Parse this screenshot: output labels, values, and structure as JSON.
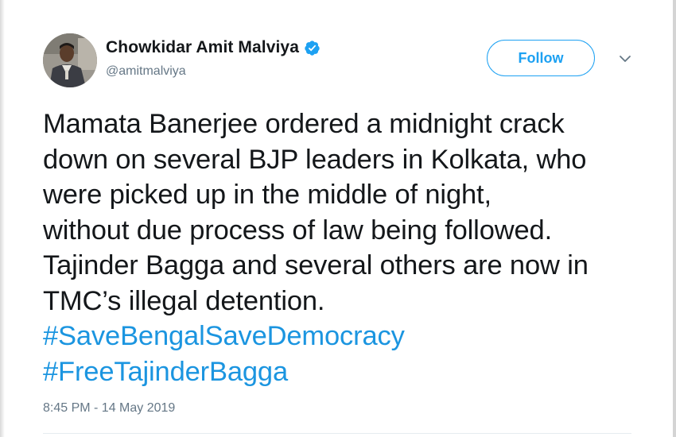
{
  "author": {
    "display_name": "Chowkidar Amit Malviya",
    "handle": "@amitmalviya",
    "verified": true
  },
  "actions": {
    "follow_label": "Follow"
  },
  "tweet": {
    "lines": [
      "Mamata Banerjee ordered a midnight crack",
      "down on several BJP leaders in Kolkata, who",
      "were picked up in the middle of night,",
      "without due process of law being followed.",
      "Tajinder Bagga and several others are now in",
      "TMC’s illegal detention."
    ],
    "hashtags": [
      "#SaveBengalSaveDemocracy",
      "#FreeTajinderBagga"
    ],
    "timestamp": "8:45 PM - 14 May 2019"
  },
  "icons": {
    "verified": "verified-badge-icon",
    "more": "chevron-down-icon"
  },
  "colors": {
    "accent": "#1da1f2",
    "hashtag": "#1b95e0",
    "text": "#14171a",
    "secondary": "#657786"
  }
}
